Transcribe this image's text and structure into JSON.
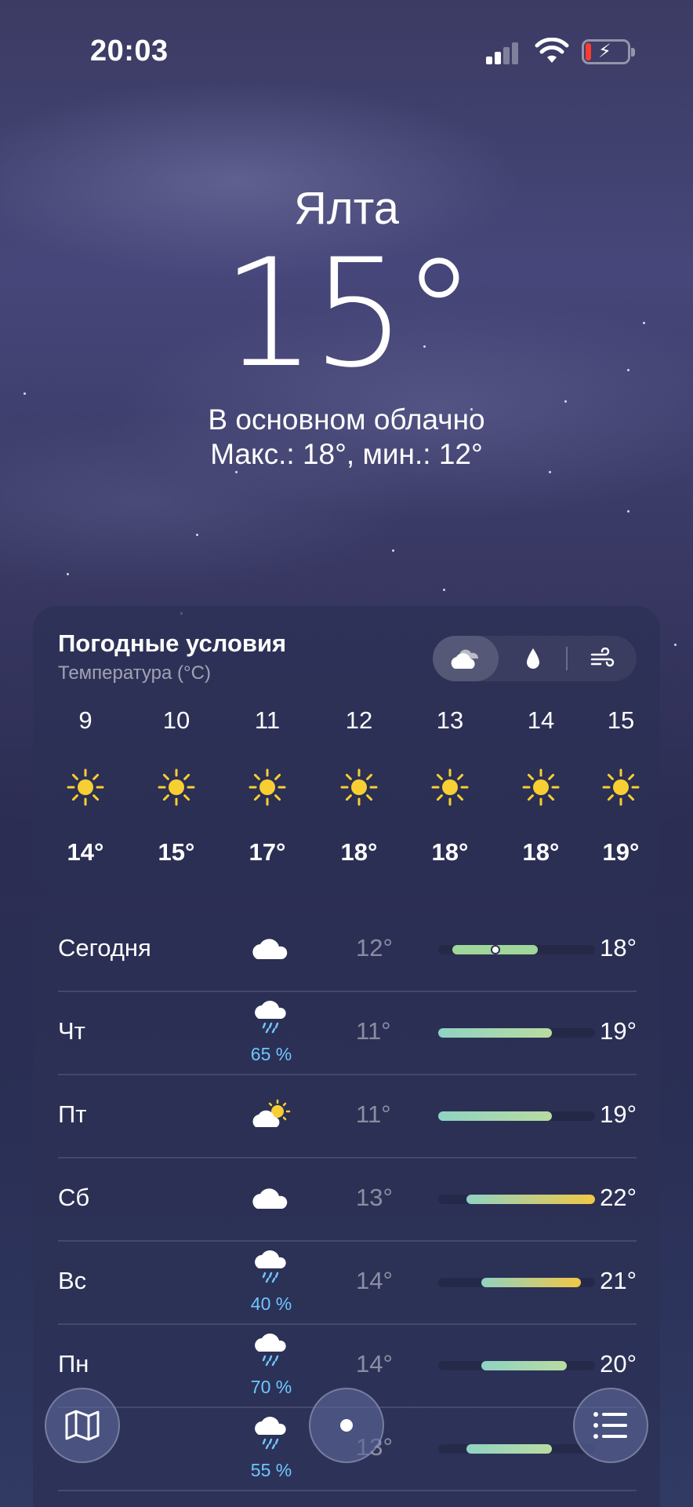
{
  "status_bar": {
    "time": "20:03"
  },
  "header": {
    "city": "Ялта",
    "temperature": "15°",
    "condition": "В основном облачно",
    "high_low": "Макс.: 18°, мин.: 12°"
  },
  "conditions": {
    "title": "Погодные условия",
    "subtitle": "Температура (°C)",
    "tabs": [
      "clouds-icon",
      "drop-icon",
      "wind-icon"
    ],
    "active_tab": 0,
    "hours": [
      {
        "hour": "9",
        "temp": "14°",
        "icon": "sun-icon"
      },
      {
        "hour": "10",
        "temp": "15°",
        "icon": "sun-icon"
      },
      {
        "hour": "11",
        "temp": "17°",
        "icon": "sun-icon"
      },
      {
        "hour": "12",
        "temp": "18°",
        "icon": "sun-icon"
      },
      {
        "hour": "13",
        "temp": "18°",
        "icon": "sun-icon"
      },
      {
        "hour": "14",
        "temp": "18°",
        "icon": "sun-icon"
      },
      {
        "hour": "15",
        "temp": "19°",
        "icon": "sun-icon"
      }
    ]
  },
  "daily": {
    "scale_min": 11,
    "scale_max": 22,
    "current_temp": 15,
    "days": [
      {
        "day": "Сегодня",
        "icon": "cloud-icon",
        "precip": "",
        "low": "12°",
        "high": "18°",
        "low_v": 12,
        "high_v": 18
      },
      {
        "day": "Чт",
        "icon": "cloud-rain-icon",
        "precip": "65 %",
        "low": "11°",
        "high": "19°",
        "low_v": 11,
        "high_v": 19
      },
      {
        "day": "Пт",
        "icon": "partly-sunny-icon",
        "precip": "",
        "low": "11°",
        "high": "19°",
        "low_v": 11,
        "high_v": 19
      },
      {
        "day": "Сб",
        "icon": "cloud-icon",
        "precip": "",
        "low": "13°",
        "high": "22°",
        "low_v": 13,
        "high_v": 22
      },
      {
        "day": "Вс",
        "icon": "cloud-rain-icon",
        "precip": "40 %",
        "low": "14°",
        "high": "21°",
        "low_v": 14,
        "high_v": 21
      },
      {
        "day": "Пн",
        "icon": "cloud-rain-icon",
        "precip": "70 %",
        "low": "14°",
        "high": "20°",
        "low_v": 14,
        "high_v": 20
      },
      {
        "day": "",
        "icon": "cloud-rain-icon",
        "precip": "55 %",
        "low": "13°",
        "high": "",
        "low_v": 13,
        "high_v": 19
      }
    ]
  },
  "colors": {
    "precip": "#6fc6ff",
    "bar_cool": "#8fd3c3",
    "bar_warm": "#f2c744"
  }
}
